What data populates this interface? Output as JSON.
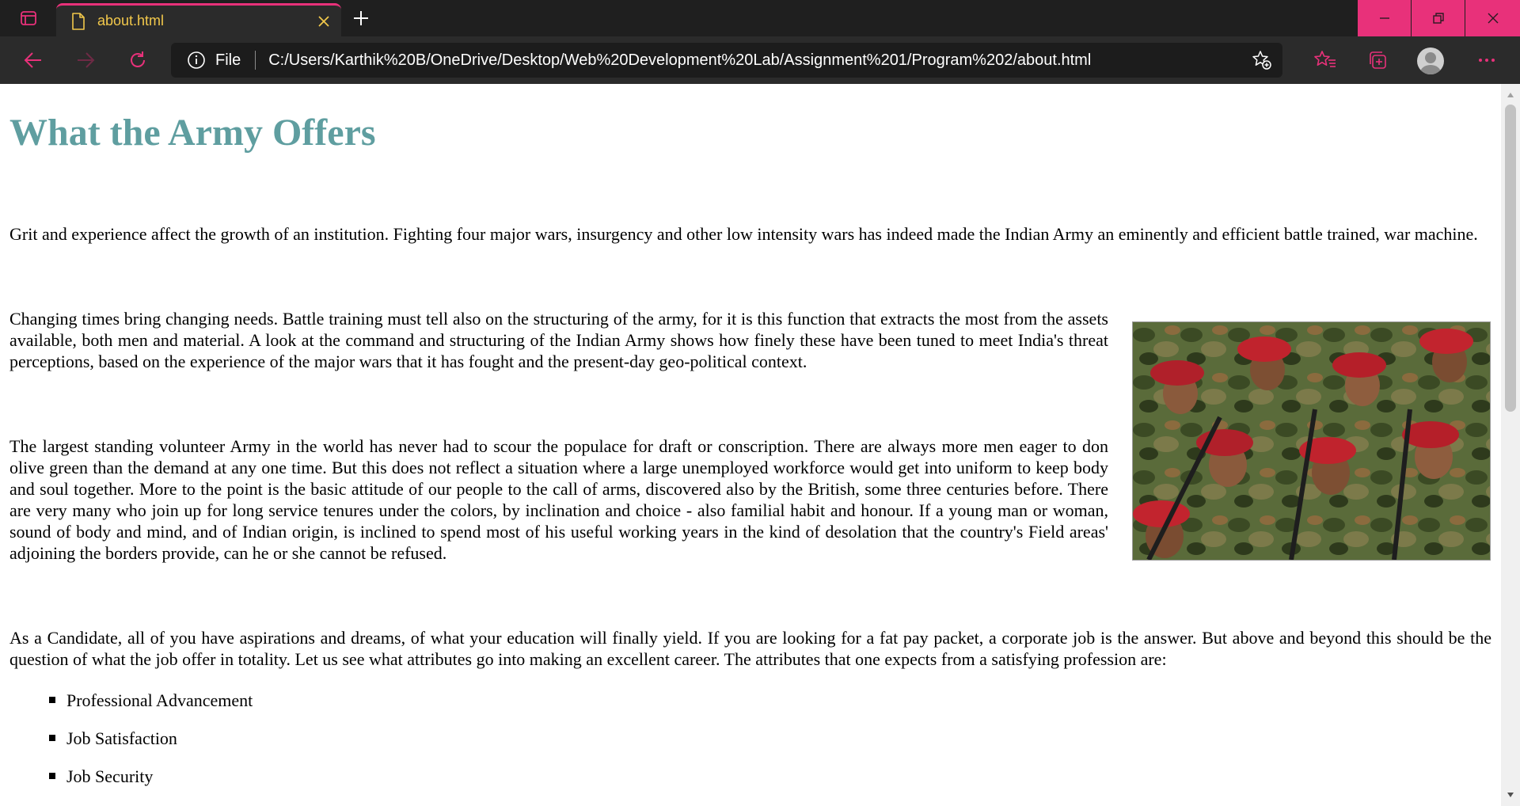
{
  "browser": {
    "tab": {
      "title": "about.html",
      "close_glyph": "✕"
    },
    "new_tab_icon": "plus-icon",
    "address_bar": {
      "scheme_label": "File",
      "url": "C:/Users/Karthik%20B/OneDrive/Desktop/Web%20Development%20Lab/Assignment%201/Program%202/about.html"
    },
    "accent_color": "#e8317a",
    "tab_text_color": "#f2c84b"
  },
  "page": {
    "title": "What the Army Offers",
    "title_color": "#5f9ea0",
    "paragraphs": [
      "Grit and experience affect the growth of an institution. Fighting four major wars, insurgency and other low intensity wars has indeed made the Indian Army an eminently and efficient battle trained, war machine.",
      "Changing times bring changing needs. Battle training must tell also on the structuring of the army, for it is this function that extracts the most from the assets available, both men and material. A look at the command and structuring of the Indian Army shows how finely these have been tuned to meet India's threat perceptions, based on the experience of the major wars that it has fought and the present-day geo-political context.",
      "The largest standing volunteer Army in the world has never had to scour the populace for draft or conscription. There are always more men eager to don olive green than the demand at any one time. But this does not reflect a situation where a large unemployed workforce would get into uniform to keep body and soul together. More to the point is the basic attitude of our people to the call of arms, discovered also by the British, some three centuries before. There are very many who join up for long service tenures under the colors, by inclination and choice - also familial habit and honour. If a young man or woman, sound of body and mind, and of Indian origin, is inclined to spend most of his useful working years in the kind of desolation that the country's Field areas' adjoining the borders provide, can he or she cannot be refused.",
      "As a Candidate, all of you have aspirations and dreams, of what your education will finally yield. If you are looking for a fat pay packet, a corporate job is the answer. But above and beyond this should be the question of what the job offer in totality. Let us see what attributes go into making an excellent career. The attributes that one expects from a satisfying profession are:"
    ],
    "attributes": [
      "Professional Advancement",
      "Job Satisfaction",
      "Job Security"
    ],
    "image": {
      "subject": "soldiers-marching-red-berets-photo"
    }
  }
}
